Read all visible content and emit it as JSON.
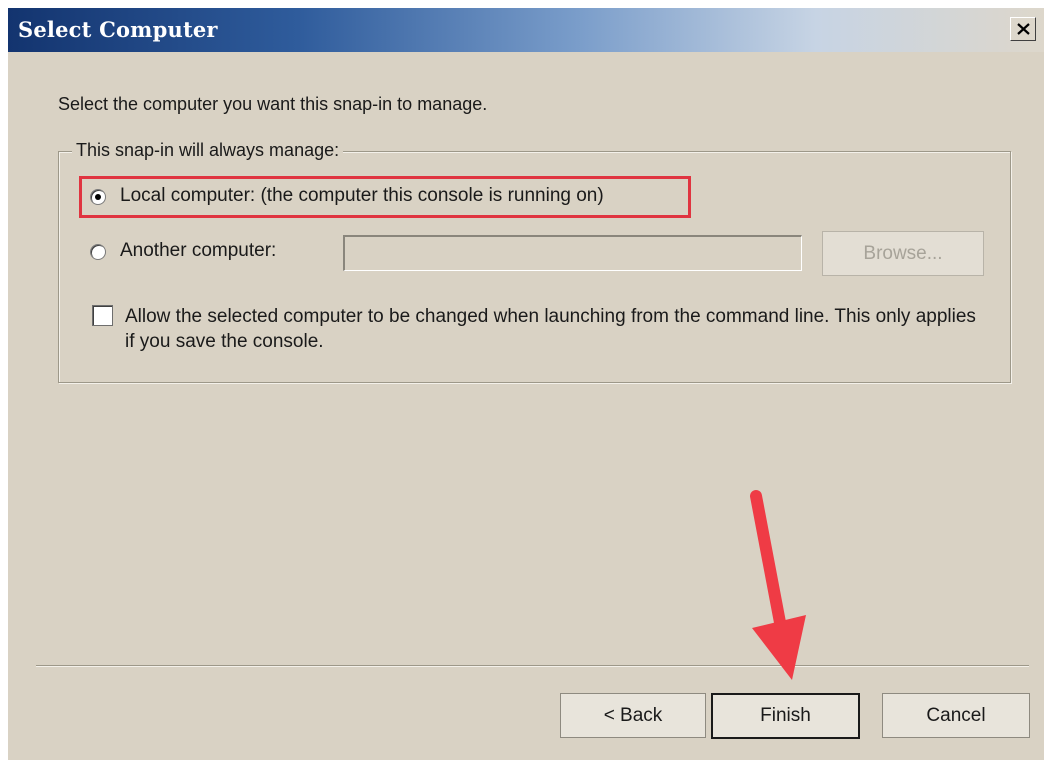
{
  "window": {
    "title": "Select Computer",
    "close_glyph": "✕"
  },
  "main": {
    "prompt": "Select the computer you want this snap-in to manage.",
    "group_label": "This snap-in will always manage:",
    "options": [
      {
        "label": "Local computer:  (the computer this console is running on)",
        "selected": true
      },
      {
        "label": "Another computer:",
        "selected": false
      }
    ],
    "computer_name_value": "",
    "browse_label": "Browse...",
    "browse_enabled": false,
    "allow_change_checkbox": {
      "checked": false,
      "label": "Allow the selected computer to be changed when launching from the command line.  This only applies if you save the console."
    }
  },
  "footer": {
    "back_label": "< Back",
    "finish_label": "Finish",
    "cancel_label": "Cancel"
  },
  "annotations": {
    "highlight_color": "#e03440",
    "arrow_color": "#ef3b45",
    "arrow_target": "finish-button"
  },
  "colors": {
    "dialog_background": "#d9d2c4",
    "title_gradient_start": "#13346f",
    "title_text": "#ffffff"
  }
}
